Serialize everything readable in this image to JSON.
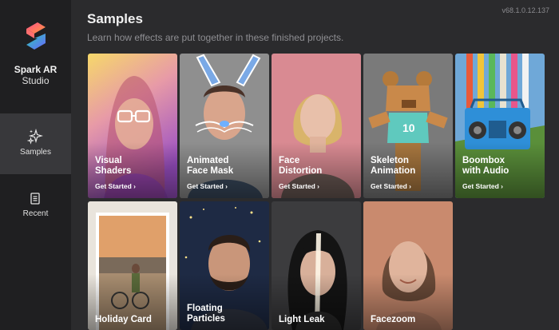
{
  "app": {
    "name_line1": "Spark AR",
    "name_line2": "Studio",
    "version": "v68.1.0.12.137"
  },
  "sidebar": {
    "items": [
      {
        "label": "Samples",
        "icon": "sparkle-icon",
        "active": true
      },
      {
        "label": "Recent",
        "icon": "document-icon",
        "active": false
      }
    ]
  },
  "header": {
    "title": "Samples",
    "subtitle": "Learn how effects are put together in these finished projects."
  },
  "samples": [
    {
      "title": "Visual\nShaders",
      "cta": "Get Started ›"
    },
    {
      "title": "Animated\nFace Mask",
      "cta": "Get Started ›"
    },
    {
      "title": "Face\nDistortion",
      "cta": "Get Started ›"
    },
    {
      "title": "Skeleton\nAnimation",
      "cta": "Get Started ›"
    },
    {
      "title": "Boombox\nwith Audio",
      "cta": "Get Started ›"
    },
    {
      "title": "Holiday Card"
    },
    {
      "title": "Floating\nParticles"
    },
    {
      "title": "Light Leak"
    },
    {
      "title": "Facezoom"
    }
  ],
  "colors": {
    "sidebar": "#1f1f21",
    "background": "#2b2b2d",
    "active_nav": "#38383b"
  }
}
